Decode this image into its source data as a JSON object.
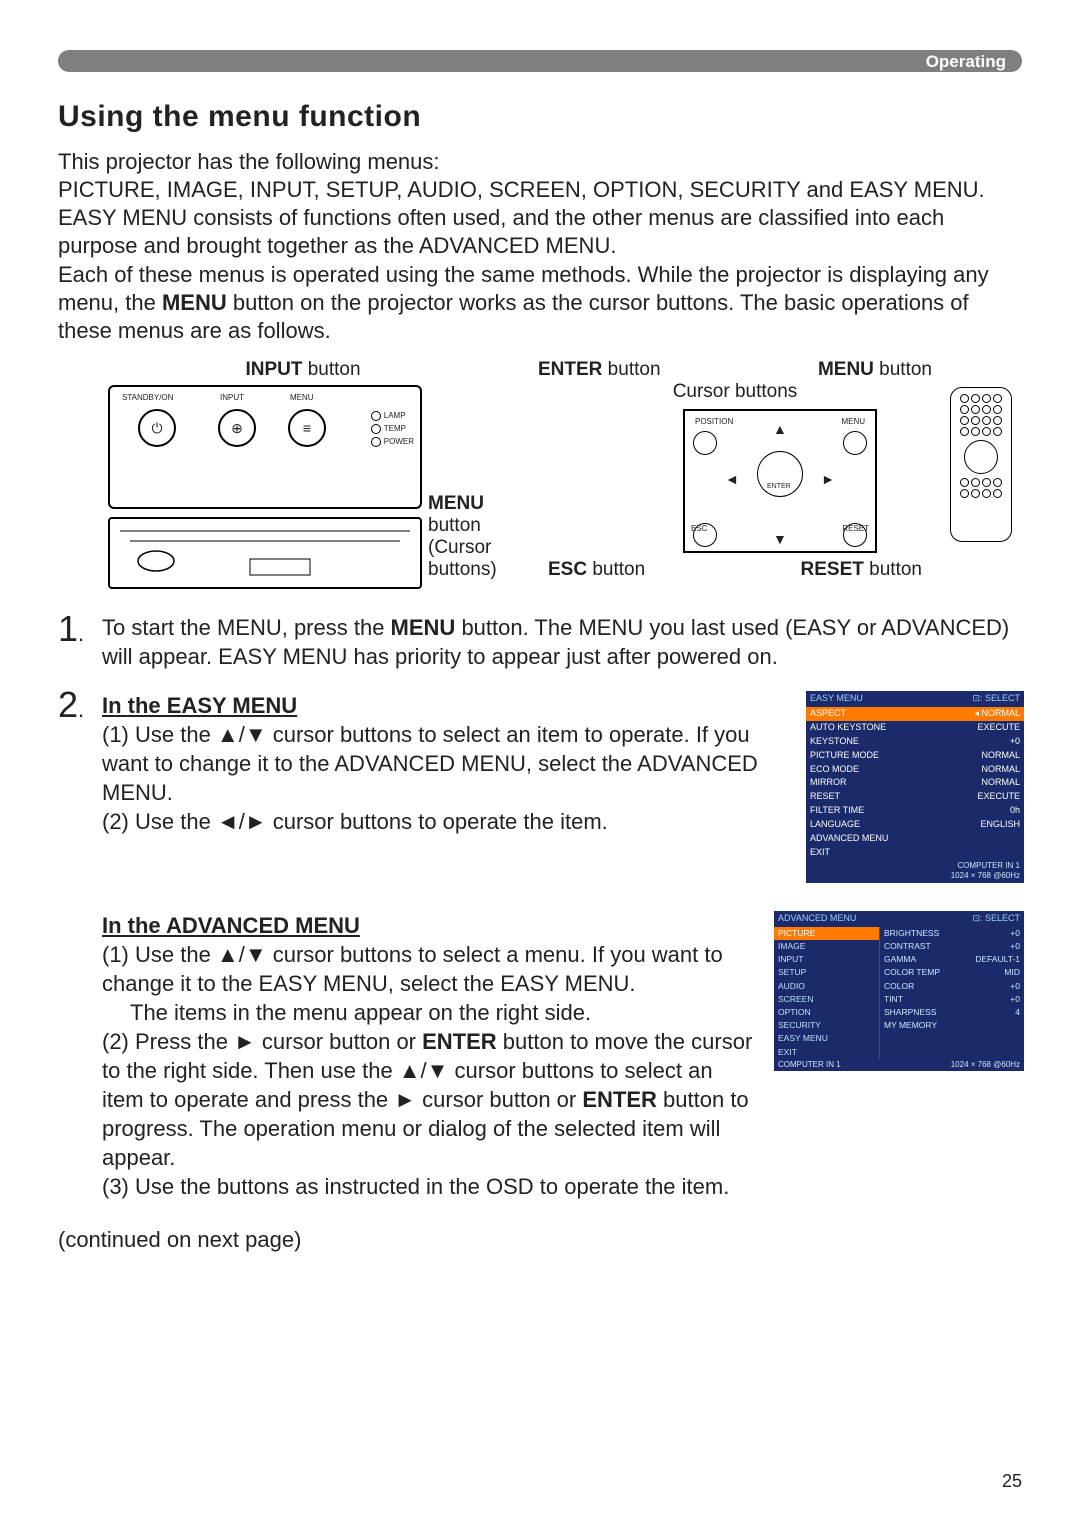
{
  "header": {
    "category": "Operating"
  },
  "section_title": "Using the menu function",
  "intro": {
    "p1": "This projector has the following menus:",
    "p2": "PICTURE, IMAGE, INPUT, SETUP, AUDIO, SCREEN, OPTION, SECURITY and EASY MENU.",
    "p3": "EASY MENU consists of functions often used, and the other menus are classified into each purpose and brought together as the ADVANCED MENU.",
    "p4_a": "Each of these menus is operated using the same methods. While the projector is displaying any menu, the ",
    "p4_b": "MENU",
    "p4_c": " button on the projector works as the cursor buttons. The basic operations of these menus are as follows."
  },
  "diagram": {
    "input_label_b": "INPUT",
    "input_label_r": " button",
    "menu_label_b": "MENU",
    "menu_label_r": " button",
    "cursor_paren": "(Cursor buttons)",
    "panel": {
      "standby": "STANDBY/ON",
      "input": "INPUT",
      "menu": "MENU",
      "lamp": "LAMP",
      "temp": "TEMP",
      "power": "POWER",
      "power_icon": "⏻",
      "input_icon": "⊕",
      "menu_icon": "≡"
    },
    "right": {
      "enter_b": "ENTER",
      "enter_r": " button",
      "menu2_b": "MENU",
      "menu2_r": " button",
      "cursor_label": "Cursor buttons",
      "esc_b": "ESC",
      "esc_r": " button",
      "reset_b": "RESET",
      "reset_r": " button",
      "position": "POSITION",
      "enter": "ENTER",
      "esc": "ESC",
      "reset": "RESET",
      "menu": "MENU"
    }
  },
  "steps": {
    "s1": {
      "num": "1",
      "text_a": "To start the MENU, press the ",
      "text_b": "MENU",
      "text_c": " button. The MENU you last used (EASY or ADVANCED) will appear. EASY MENU has priority to appear just after powered on."
    },
    "s2": {
      "num": "2",
      "easy_head": "In the EASY MENU",
      "easy_1": "(1) Use the ▲/▼ cursor buttons to select an item to operate. If you want to change it to the ADVANCED MENU, select the ADVANCED MENU.",
      "easy_2": "(2) Use the ◄/► cursor buttons to operate the item.",
      "adv_head": "In the ADVANCED MENU",
      "adv_1": "(1) Use the ▲/▼ cursor buttons to select a menu. If you want to change it to the EASY MENU, select the EASY MENU.",
      "adv_1b": "The items in the menu appear on the right side.",
      "adv_2_a": "(2) Press the ► cursor button or ",
      "adv_2_b": "ENTER",
      "adv_2_c": " button to move the cursor to the right side. Then use the ▲/▼ cursor buttons to select an item to operate and press the ► cursor button or ",
      "adv_2_d": "ENTER",
      "adv_2_e": " button to progress. The operation menu or dialog of the selected item will appear.",
      "adv_3": "(3) Use the buttons as instructed in the OSD to operate the item."
    }
  },
  "osd_easy": {
    "title": "EASY MENU",
    "select": "⊡: SELECT",
    "rows": [
      {
        "l": "ASPECT",
        "r": "◂ NORMAL",
        "sel": true
      },
      {
        "l": "AUTO KEYSTONE",
        "r": "EXECUTE"
      },
      {
        "l": "KEYSTONE",
        "r": "+0"
      },
      {
        "l": "PICTURE MODE",
        "r": "NORMAL"
      },
      {
        "l": "ECO MODE",
        "r": "NORMAL"
      },
      {
        "l": "MIRROR",
        "r": "NORMAL"
      },
      {
        "l": "RESET",
        "r": "EXECUTE"
      },
      {
        "l": "FILTER TIME",
        "r": "0h"
      },
      {
        "l": "LANGUAGE",
        "r": "ENGLISH"
      },
      {
        "l": "ADVANCED MENU",
        "r": ""
      },
      {
        "l": "EXIT",
        "r": ""
      }
    ],
    "foot1": "COMPUTER IN 1",
    "foot2": "1024 × 768 @60Hz"
  },
  "osd_adv": {
    "title": "ADVANCED MENU",
    "select": "⊡: SELECT",
    "left": [
      {
        "l": "PICTURE",
        "sel": true
      },
      {
        "l": "IMAGE"
      },
      {
        "l": "INPUT"
      },
      {
        "l": "SETUP"
      },
      {
        "l": "AUDIO"
      },
      {
        "l": "SCREEN"
      },
      {
        "l": "OPTION"
      },
      {
        "l": "SECURITY"
      },
      {
        "l": "EASY MENU"
      },
      {
        "l": "EXIT"
      }
    ],
    "right": [
      {
        "l": "BRIGHTNESS",
        "r": "+0"
      },
      {
        "l": "CONTRAST",
        "r": "+0"
      },
      {
        "l": "GAMMA",
        "r": "DEFAULT-1"
      },
      {
        "l": "COLOR TEMP",
        "r": "MID"
      },
      {
        "l": "COLOR",
        "r": "+0"
      },
      {
        "l": "TINT",
        "r": "+0"
      },
      {
        "l": "SHARPNESS",
        "r": "4"
      },
      {
        "l": "MY MEMORY",
        "r": ""
      }
    ],
    "foot1": "COMPUTER IN 1",
    "foot2": "1024 × 768 @60Hz"
  },
  "cont": "(continued on next page)",
  "page_no": "25"
}
